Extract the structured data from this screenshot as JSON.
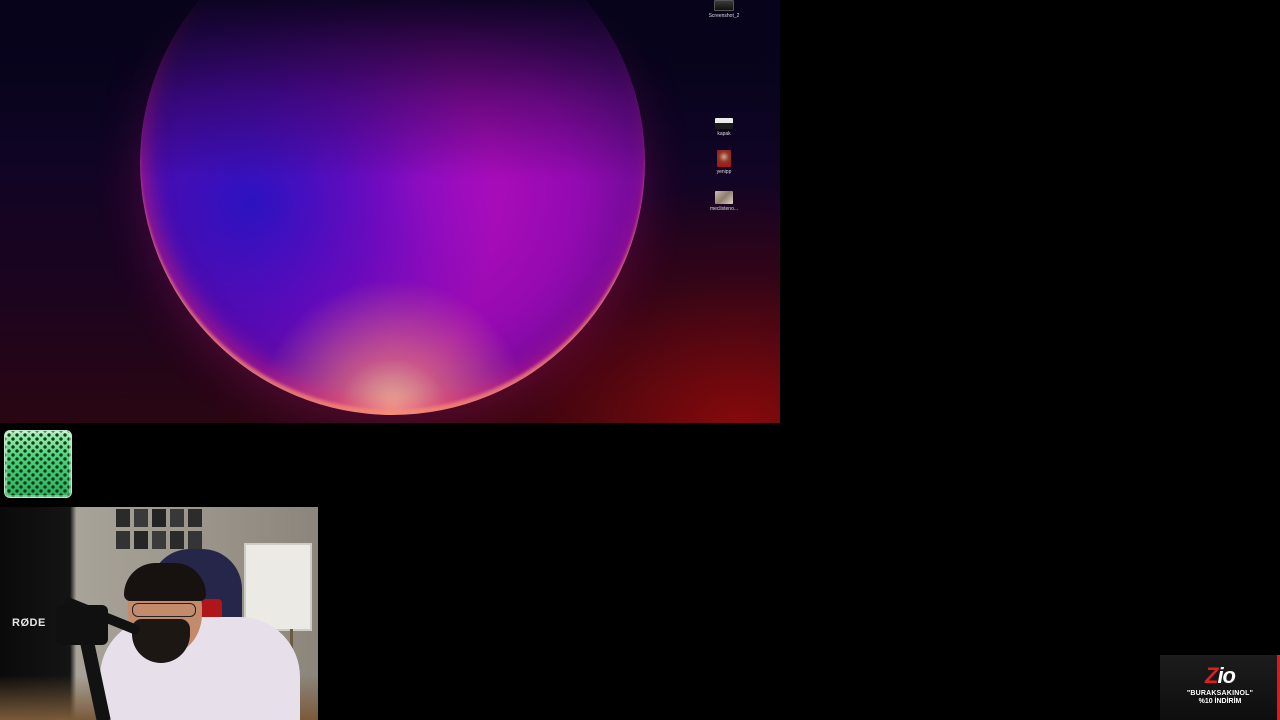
{
  "desktop": {
    "icons": [
      {
        "label": "Screenshot_2",
        "icon": "image-file-icon"
      },
      {
        "label": "kapak",
        "icon": "image-file-icon"
      },
      {
        "label": "yenipp",
        "icon": "image-file-icon"
      },
      {
        "label": "meclisteno...",
        "icon": "image-file-icon"
      }
    ]
  },
  "webcam": {
    "mic_brand": "RØDE"
  },
  "ad": {
    "logo_red": "Z",
    "logo_white": "io",
    "promo_code": "\"BURAKSAKINOL\"",
    "discount": "%10 İNDİRİM",
    "accent": "#e01e1e"
  },
  "colors": {
    "page_background": "#000000",
    "orb_core": "#c20fc8"
  }
}
